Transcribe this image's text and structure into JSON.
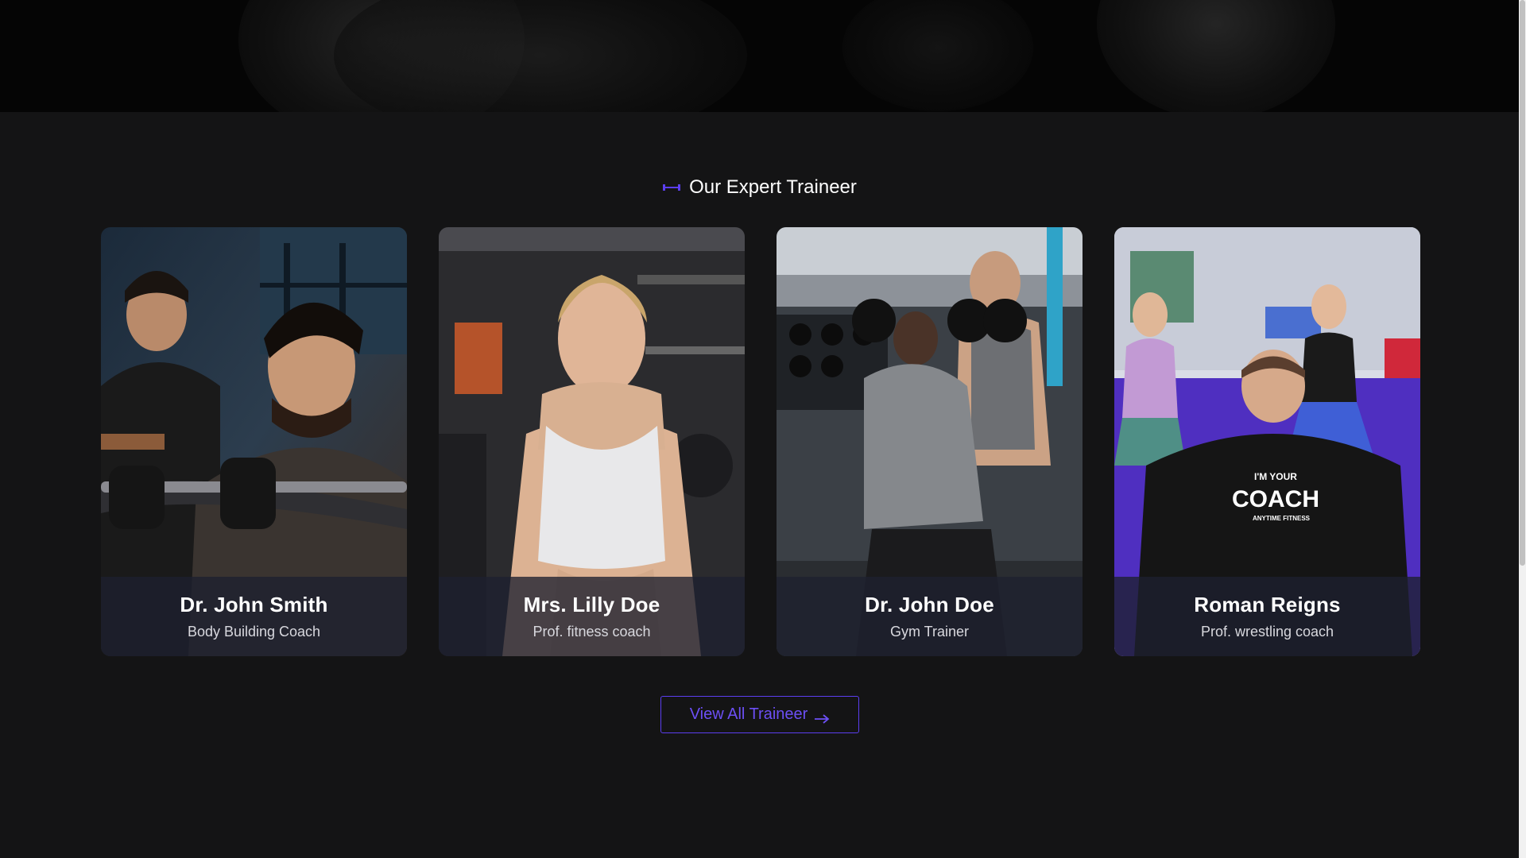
{
  "section": {
    "title": "Our Expert Traineer",
    "accent_color": "#5b3ef0",
    "title_icon": "dumbbell-icon"
  },
  "trainers": [
    {
      "name": "Dr. John Smith",
      "role": "Body Building Coach"
    },
    {
      "name": "Mrs. Lilly Doe",
      "role": "Prof. fitness coach"
    },
    {
      "name": "Dr. John Doe",
      "role": "Gym Trainer"
    },
    {
      "name": "Roman Reigns",
      "role": "Prof. wrestling coach",
      "shirt_text": {
        "line1": "I'M YOUR",
        "line2": "COACH",
        "line3": "ANYTIME FITNESS"
      }
    }
  ],
  "cta": {
    "label": "View All Traineer",
    "icon": "arrow-right-icon"
  }
}
